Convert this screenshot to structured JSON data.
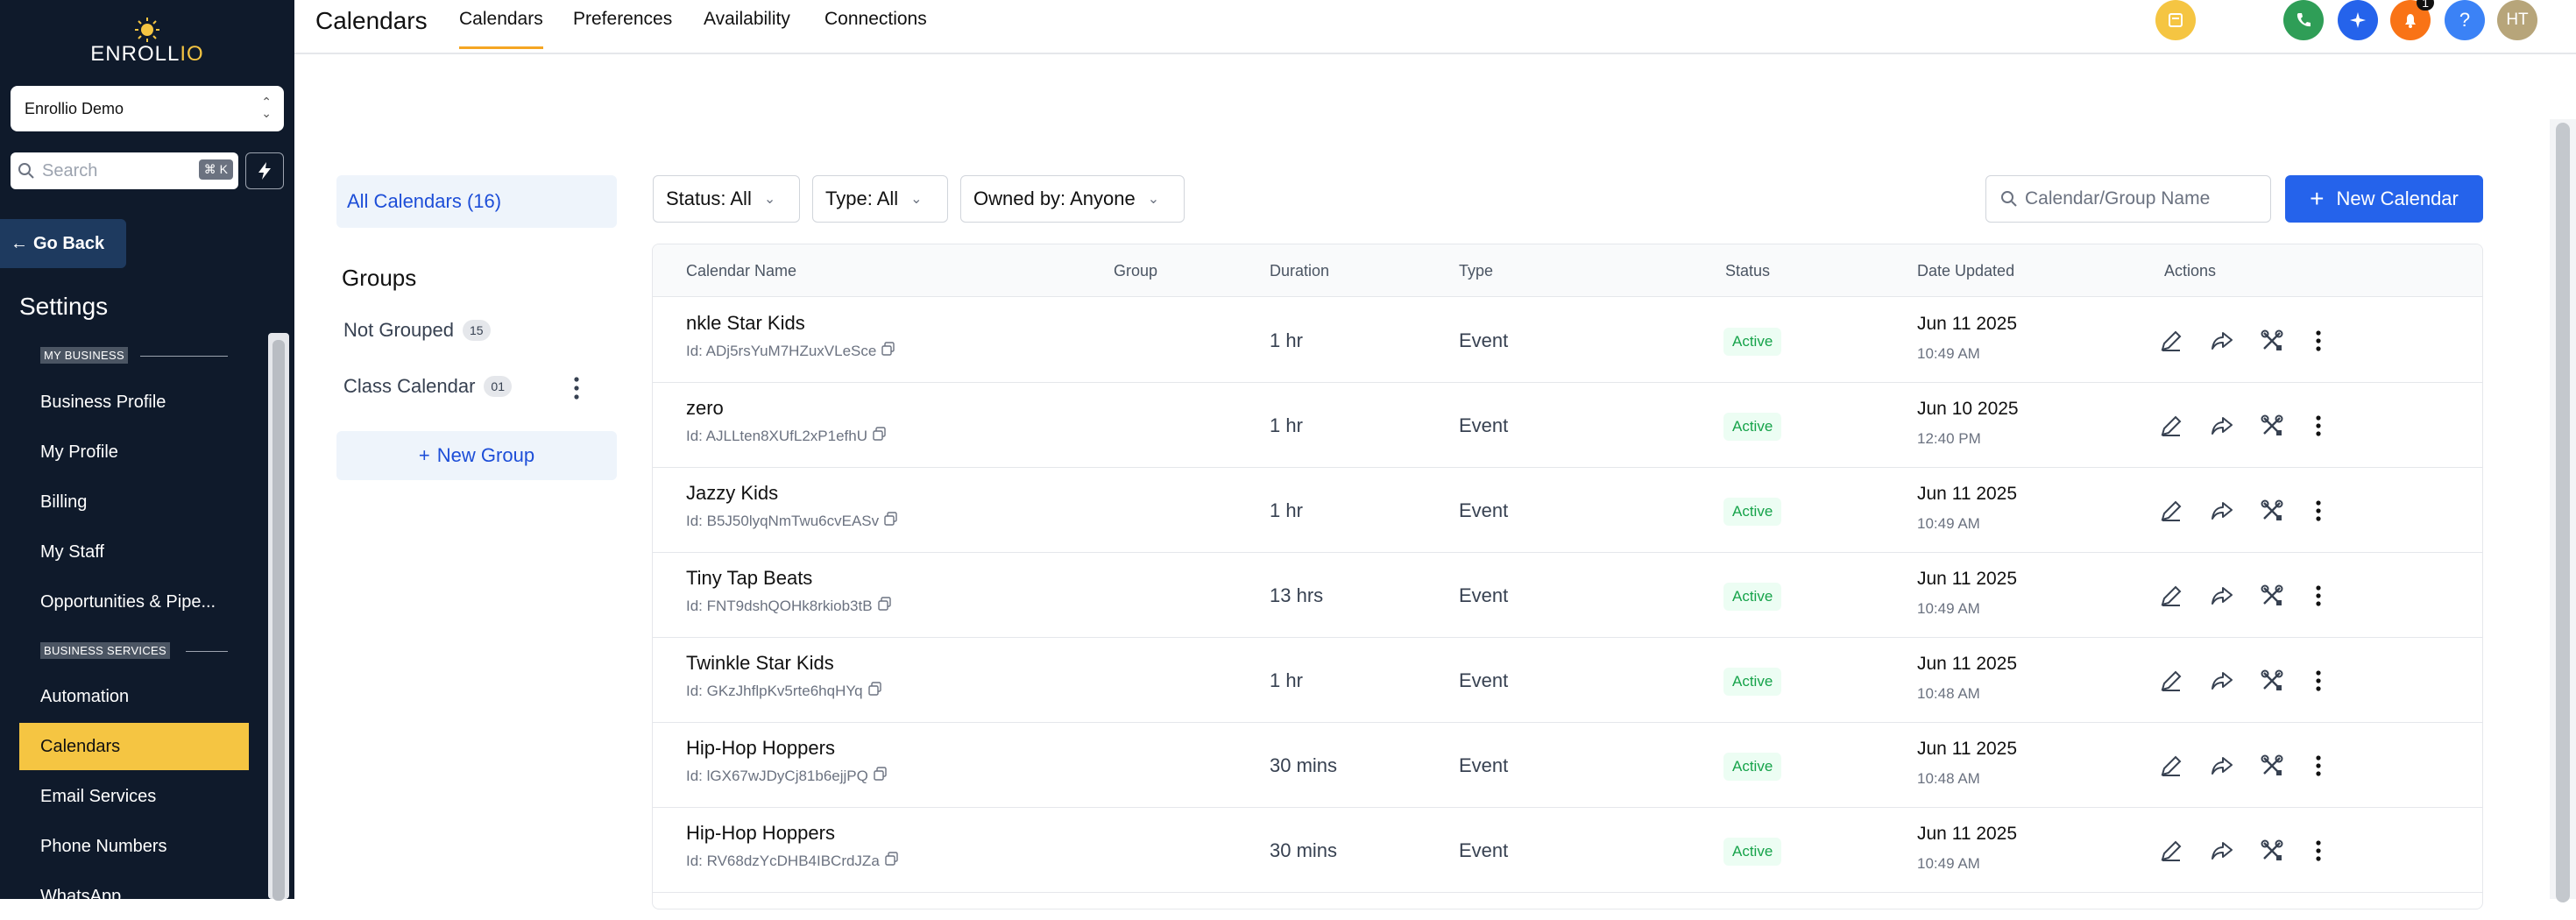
{
  "sidebar": {
    "logo": {
      "main": "ENROLL",
      "accent": "IO"
    },
    "account": "Enrollio Demo",
    "search_placeholder": "Search",
    "search_shortcut": "⌘ K",
    "go_back": "Go Back",
    "settings_title": "Settings",
    "sections": [
      {
        "label": "MY BUSINESS"
      },
      {
        "label": "BUSINESS SERVICES"
      }
    ],
    "items_business": [
      "Business Profile",
      "My Profile",
      "Billing",
      "My Staff",
      "Opportunities & Pipe..."
    ],
    "items_services": [
      "Automation",
      "Calendars",
      "Email Services",
      "Phone Numbers",
      "WhatsApp"
    ],
    "active_item": "Calendars"
  },
  "topbar": {
    "title": "Calendars",
    "tabs": [
      "Calendars",
      "Preferences",
      "Availability",
      "Connections"
    ],
    "active_tab": "Calendars",
    "notification_count": "1",
    "help_label": "?",
    "avatar_initials": "HT",
    "colors": {
      "note": "#f5c542",
      "phone": "#2f9e57",
      "ai": "#2563eb",
      "bell": "#f97316",
      "help": "#3b82f6",
      "avatar": "#b7a57a"
    }
  },
  "left_panel": {
    "all_calendars": "All Calendars (16)",
    "groups_heading": "Groups",
    "groups": [
      {
        "name": "Not Grouped",
        "count": "15"
      },
      {
        "name": "Class Calendar",
        "count": "01"
      }
    ],
    "new_group": "New Group"
  },
  "filters": {
    "status": "Status: All",
    "type": "Type: All",
    "owned_by": "Owned by: Anyone",
    "search_placeholder": "Calendar/Group Name",
    "new_calendar": "New Calendar"
  },
  "table": {
    "headers": [
      "Calendar Name",
      "Group",
      "Duration",
      "Type",
      "Status",
      "Date Updated",
      "Actions"
    ],
    "rows": [
      {
        "name": "nkle Star Kids",
        "id": "Id: ADj5rsYuM7HZuxVLeSce",
        "group": "",
        "duration": "1 hr",
        "type": "Event",
        "status": "Active",
        "date": "Jun 11 2025",
        "time": "10:49 AM"
      },
      {
        "name": "zero",
        "id": "Id: AJLLten8XUfL2xP1efhU",
        "group": "",
        "duration": "1 hr",
        "type": "Event",
        "status": "Active",
        "date": "Jun 10 2025",
        "time": "12:40 PM"
      },
      {
        "name": "Jazzy Kids",
        "id": "Id: B5J50lyqNmTwu6cvEASv",
        "group": "",
        "duration": "1 hr",
        "type": "Event",
        "status": "Active",
        "date": "Jun 11 2025",
        "time": "10:49 AM"
      },
      {
        "name": "Tiny Tap Beats",
        "id": "Id: FNT9dshQOHk8rkiob3tB",
        "group": "",
        "duration": "13 hrs",
        "type": "Event",
        "status": "Active",
        "date": "Jun 11 2025",
        "time": "10:49 AM"
      },
      {
        "name": "Twinkle Star Kids",
        "id": "Id: GKzJhflpKv5rte6hqHYq",
        "group": "",
        "duration": "1 hr",
        "type": "Event",
        "status": "Active",
        "date": "Jun 11 2025",
        "time": "10:48 AM"
      },
      {
        "name": "Hip-Hop Hoppers",
        "id": "Id: lGX67wJDyCj81b6ejjPQ",
        "group": "",
        "duration": "30 mins",
        "type": "Event",
        "status": "Active",
        "date": "Jun 11 2025",
        "time": "10:48 AM"
      },
      {
        "name": "Hip-Hop Hoppers",
        "id": "Id: RV68dzYcDHB4IBCrdJZa",
        "group": "",
        "duration": "30 mins",
        "type": "Event",
        "status": "Active",
        "date": "Jun 11 2025",
        "time": "10:49 AM"
      }
    ]
  }
}
